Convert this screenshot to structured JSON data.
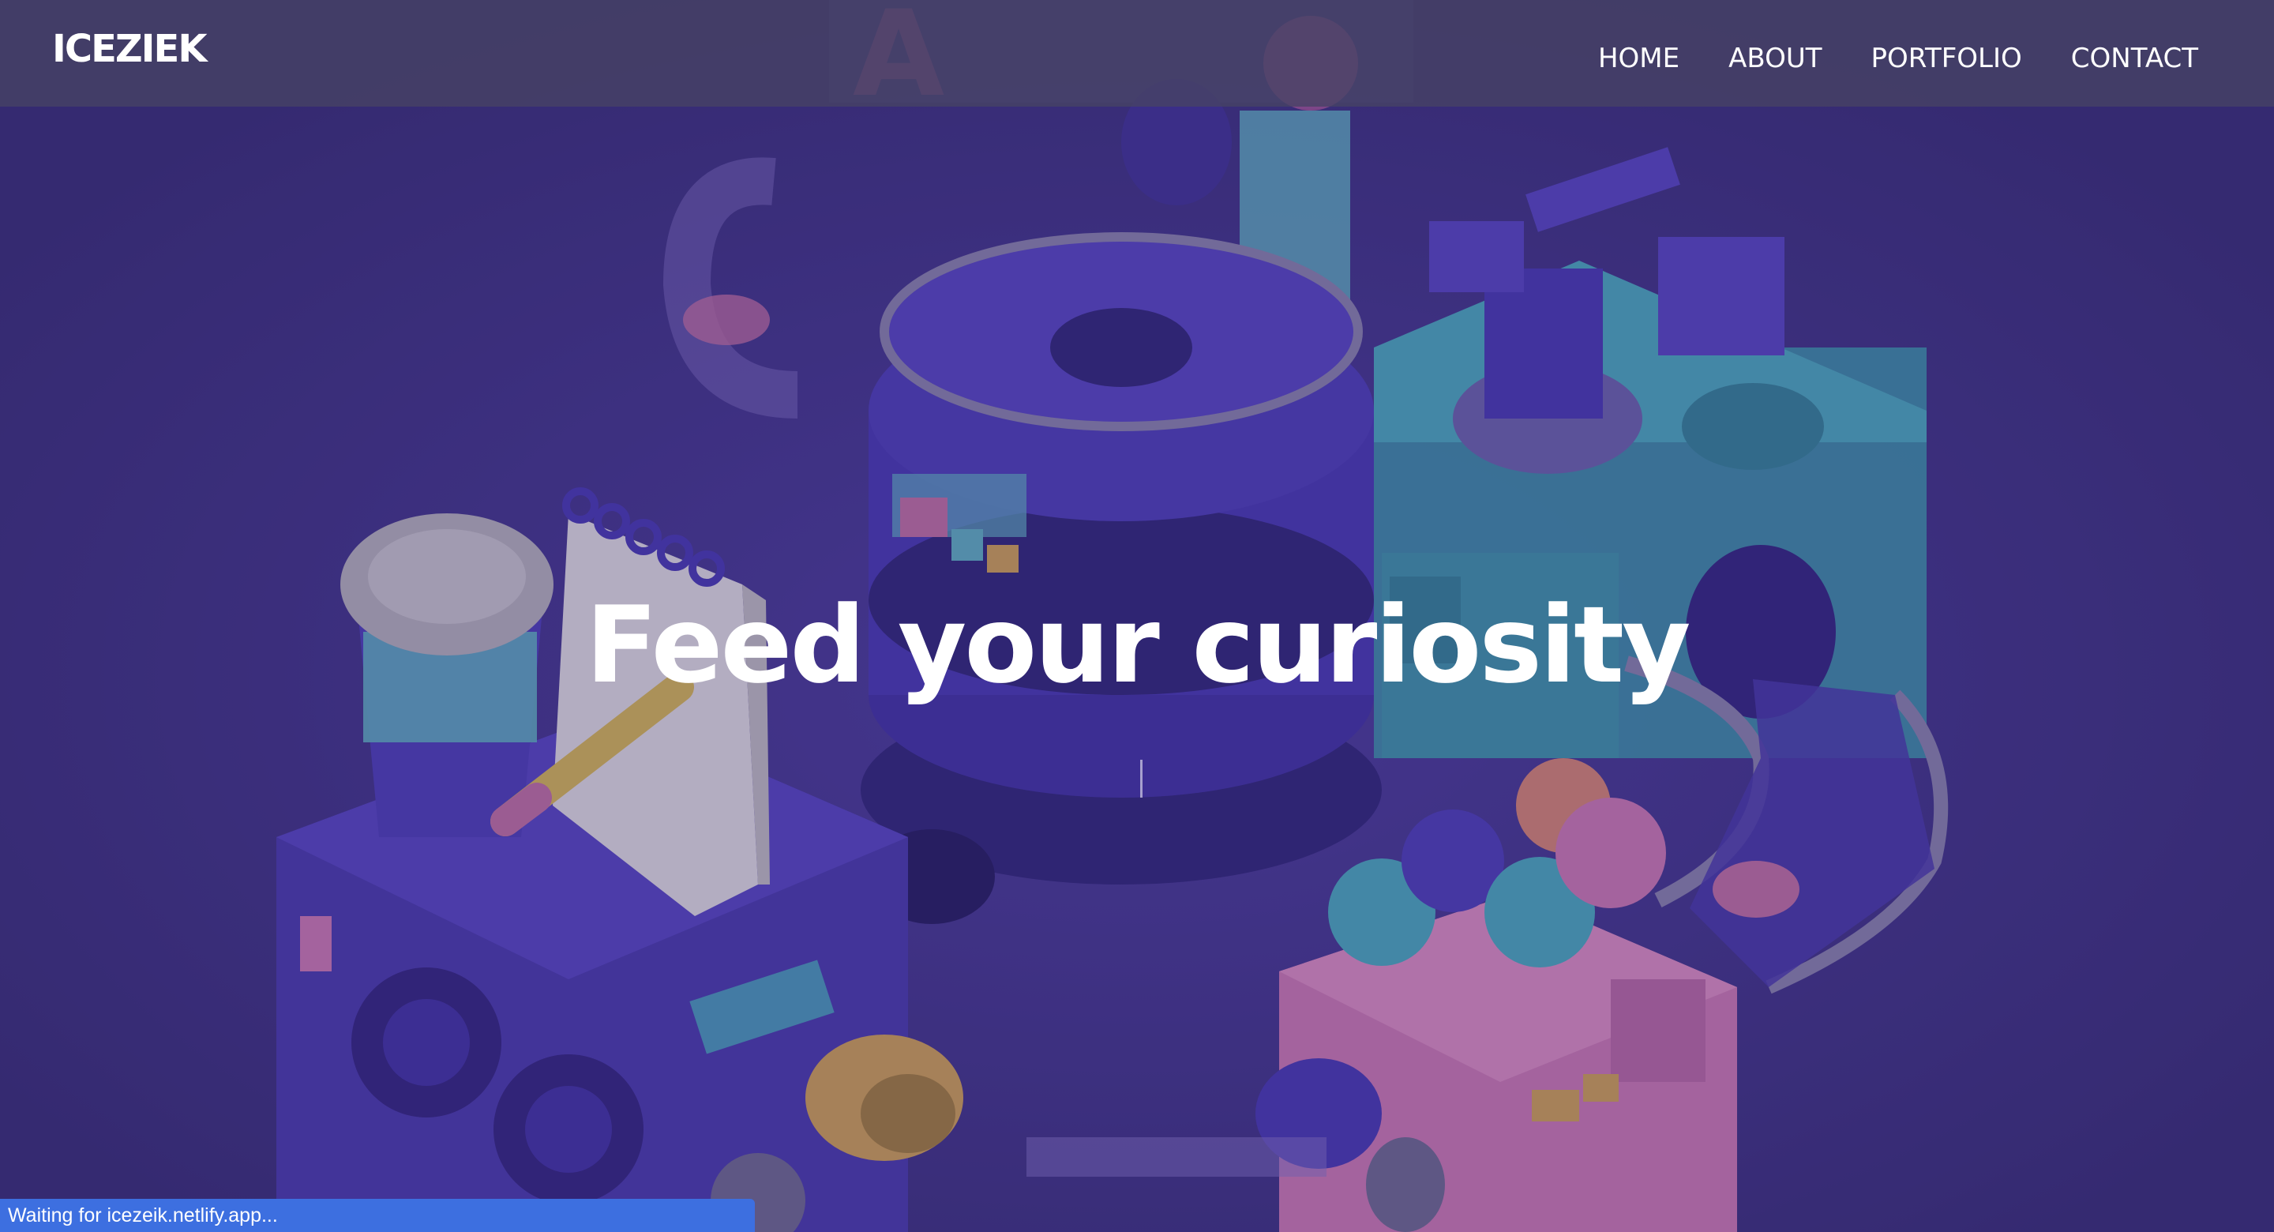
{
  "brand": {
    "logo": "ICEZIEK"
  },
  "nav": {
    "items": [
      {
        "label": "HOME"
      },
      {
        "label": "ABOUT"
      },
      {
        "label": "PORTFOLIO"
      },
      {
        "label": "CONTACT"
      }
    ]
  },
  "hero": {
    "title": "Feed your curiosity"
  },
  "status_bar": {
    "text": "Waiting for icezeik.netlify.app..."
  },
  "colors": {
    "background": "#3a2e7a",
    "navbar": "#464264",
    "status_bar": "#3d6fe0",
    "text": "#ffffff"
  }
}
